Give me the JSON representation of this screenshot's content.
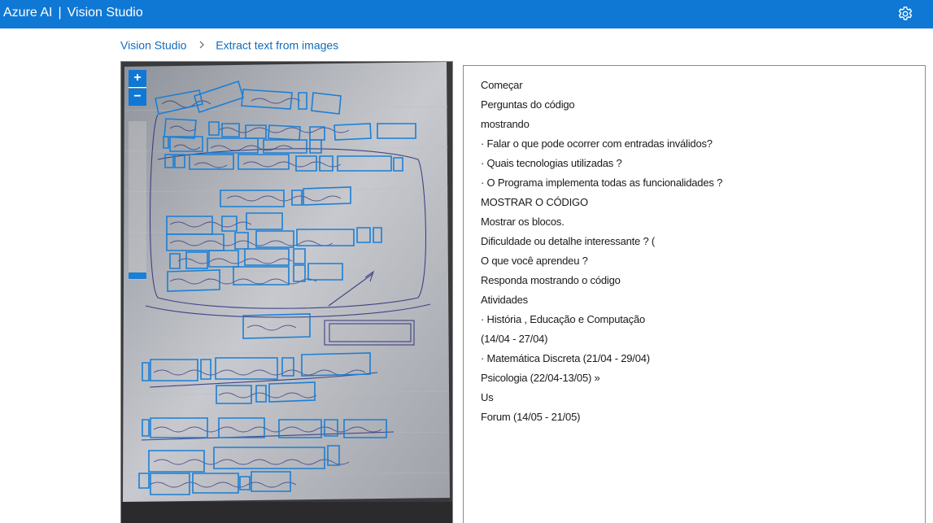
{
  "header": {
    "brand": "Azure AI",
    "separator": "|",
    "product": "Vision Studio",
    "settings_icon": "gear-icon"
  },
  "breadcrumb": {
    "items": [
      "Vision Studio",
      "Extract text from images"
    ],
    "separator_icon": "chevron-right-icon"
  },
  "image_viewer": {
    "zoom_in_label": "+",
    "zoom_out_label": "−"
  },
  "extracted_text": {
    "lines": [
      "Começar",
      "Perguntas do código",
      "mostrando",
      "· Falar o que pode ocorrer com entradas inválidos?",
      "· Quais tecnologias utilizadas ?",
      "· O Programa implementa todas as funcionalidades ?",
      "MOSTRAR O CÓDIGO",
      "Mostrar os blocos.",
      "Dificuldade ou detalhe interessante ? (",
      "O que você aprendeu ?",
      "Responda mostrando o código",
      "Atividades",
      "· História , Educação e Computação",
      "(14/04 - 27/04)",
      "· Matemática Discreta (21/04 - 29/04)",
      "Psicologia (22/04-13/05) »",
      "Us",
      "Forum (14/05 - 21/05)"
    ]
  },
  "colors": {
    "header_bg": "#0f78d4",
    "link": "#0f6cbd",
    "bounding_box": "#1a7fd6"
  }
}
